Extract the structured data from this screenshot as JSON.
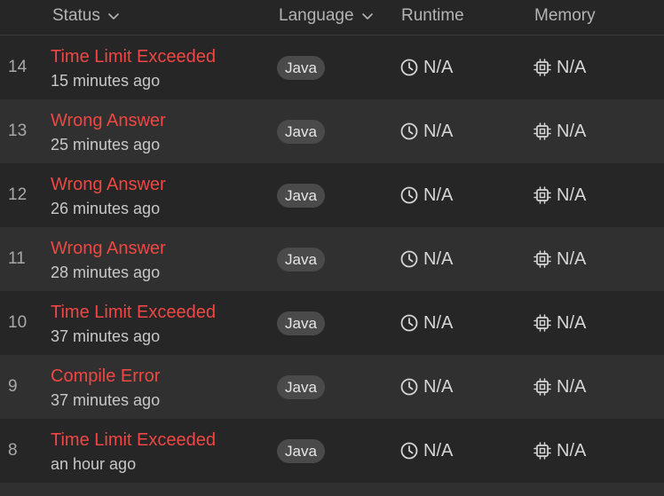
{
  "header": {
    "status": "Status",
    "language": "Language",
    "runtime": "Runtime",
    "memory": "Memory"
  },
  "rows": [
    {
      "index": "14",
      "status": "Time Limit Exceeded",
      "time": "15 minutes ago",
      "language": "Java",
      "runtime": "N/A",
      "memory": "N/A"
    },
    {
      "index": "13",
      "status": "Wrong Answer",
      "time": "25 minutes ago",
      "language": "Java",
      "runtime": "N/A",
      "memory": "N/A"
    },
    {
      "index": "12",
      "status": "Wrong Answer",
      "time": "26 minutes ago",
      "language": "Java",
      "runtime": "N/A",
      "memory": "N/A"
    },
    {
      "index": "11",
      "status": "Wrong Answer",
      "time": "28 minutes ago",
      "language": "Java",
      "runtime": "N/A",
      "memory": "N/A"
    },
    {
      "index": "10",
      "status": "Time Limit Exceeded",
      "time": "37 minutes ago",
      "language": "Java",
      "runtime": "N/A",
      "memory": "N/A"
    },
    {
      "index": "9",
      "status": "Compile Error",
      "time": "37 minutes ago",
      "language": "Java",
      "runtime": "N/A",
      "memory": "N/A"
    },
    {
      "index": "8",
      "status": "Time Limit Exceeded",
      "time": "an hour ago",
      "language": "Java",
      "runtime": "N/A",
      "memory": "N/A"
    }
  ],
  "colors": {
    "error_status": "#ef4743",
    "background": "#262626",
    "alt_row": "#303030",
    "badge_bg": "#4a4a4a"
  },
  "icons": {
    "sort": "chevron-down-icon",
    "runtime": "clock-icon",
    "memory": "chip-icon"
  }
}
